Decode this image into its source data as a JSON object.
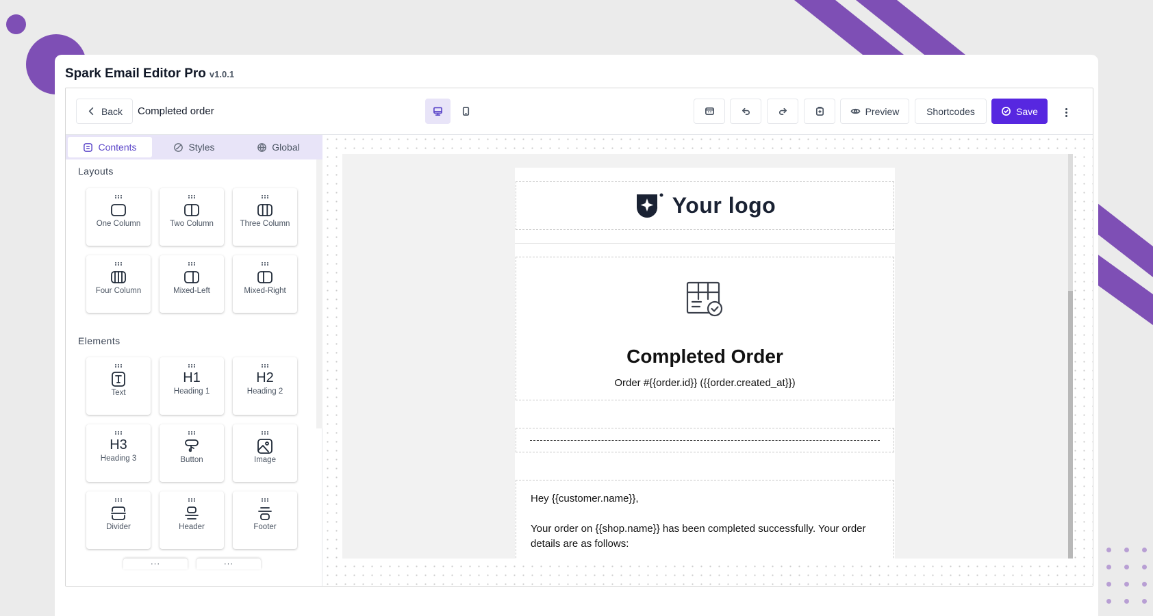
{
  "app": {
    "title": "Spark Email Editor Pro",
    "version": "v1.0.1"
  },
  "toolbar": {
    "back_label": "Back",
    "document_name": "Completed order",
    "device_desktop_icon": "monitor-icon",
    "device_tablet_icon": "tablet-icon",
    "preview_label": "Preview",
    "shortcodes_label": "Shortcodes",
    "save_label": "Save",
    "accent_color": "#5727e0"
  },
  "sidebar": {
    "tabs": [
      {
        "label": "Contents",
        "icon": "list-icon",
        "active": true
      },
      {
        "label": "Styles",
        "icon": "brush-icon",
        "active": false
      },
      {
        "label": "Global",
        "icon": "globe-icon",
        "active": false
      }
    ],
    "layouts_title": "Layouts",
    "layouts": [
      {
        "label": "One Column",
        "icon": "one-column-icon"
      },
      {
        "label": "Two Column",
        "icon": "two-column-icon"
      },
      {
        "label": "Three Column",
        "icon": "three-column-icon"
      },
      {
        "label": "Four Column",
        "icon": "four-column-icon"
      },
      {
        "label": "Mixed-Left",
        "icon": "mixed-left-icon"
      },
      {
        "label": "Mixed-Right",
        "icon": "mixed-right-icon"
      }
    ],
    "elements_title": "Elements",
    "elements": [
      {
        "label": "Text",
        "icon": "text-icon"
      },
      {
        "label": "Heading 1",
        "glyph": "H1"
      },
      {
        "label": "Heading 2",
        "glyph": "H2"
      },
      {
        "label": "Heading 3",
        "glyph": "H3"
      },
      {
        "label": "Button",
        "icon": "button-icon"
      },
      {
        "label": "Image",
        "icon": "image-icon"
      },
      {
        "label": "Divider",
        "icon": "divider-icon"
      },
      {
        "label": "Header",
        "icon": "header-icon"
      },
      {
        "label": "Footer",
        "icon": "footer-icon"
      }
    ]
  },
  "email": {
    "logo_text": "Your logo",
    "title": "Completed Order",
    "subtitle": "Order #{{order.id}} ({{order.created_at}})",
    "greeting": "Hey {{customer.name}},",
    "body": "Your order on {{shop.name}} has been completed successfully. Your order details are as follows:"
  }
}
